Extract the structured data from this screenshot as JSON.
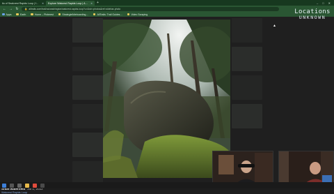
{
  "browser": {
    "tabs": [
      {
        "label": "tio of Sealcrest Rapids Loop | f…",
        "active": false
      },
      {
        "label": "Explore Watcrest Rapids Loop | A…",
        "active": true
      }
    ],
    "new_tab": "+",
    "url": "alltrails.com/trail/us/washington/watcrest-rapids-loop?u=i&sh=photos&ref=sidebar-photo",
    "bookmarks": [
      "Apps",
      "Earth",
      "Home – Pinterest",
      "Strategie/kiteboarding…",
      "AllTrails: Trail Guides…",
      "Video Scraping"
    ],
    "icons": {
      "back": "back-arrow-icon",
      "forward": "forward-arrow-icon",
      "reload": "reload-icon",
      "lock": "lock-icon"
    }
  },
  "caption": {
    "author": "Shun waterfield",
    "date": "Jul 1, 2022",
    "trail": "Watcrest Rapids Loop"
  },
  "logo": {
    "line1": "Locations",
    "line2": "UNKNOWN"
  },
  "colors": {
    "chrome": "#2a5633",
    "tabbar": "#17381f",
    "page": "#1f1f1f",
    "link": "#7fa3d9"
  }
}
